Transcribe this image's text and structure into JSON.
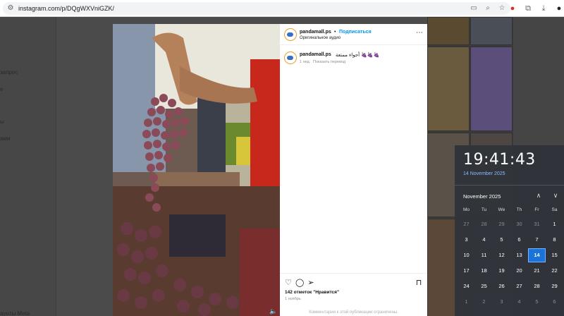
{
  "browser": {
    "url": "instagram.com/p/DQgWXVniGZK/"
  },
  "sidebar": {
    "items": [
      "запрос",
      "е",
      "ы",
      "ами",
      "аунты Meta"
    ]
  },
  "post": {
    "username": "pandamall.ps",
    "follow_separator": "•",
    "follow_label": "Подписаться",
    "audio_label": "Оригинальное аудио",
    "caption_username": "pandamall.ps",
    "caption_text": "أجواء ممتعة 🍇🍇🍇",
    "caption_age": "1 нед.",
    "translate_label": "Показать перевод",
    "likes": "142 отметок \"Нравится\"",
    "date": "1 ноябрь",
    "comments_off": "Комментарии к этой публикации ограничены."
  },
  "clock": {
    "time": "19:41:43",
    "date": "14 November 2025",
    "month": "November 2025",
    "weekdays": [
      "Mo",
      "Tu",
      "We",
      "Th",
      "Fr",
      "Sa"
    ],
    "weeks": [
      [
        "27",
        "28",
        "29",
        "30",
        "31",
        "1"
      ],
      [
        "3",
        "4",
        "5",
        "6",
        "7",
        "8"
      ],
      [
        "10",
        "11",
        "12",
        "13",
        "14",
        "15"
      ],
      [
        "17",
        "18",
        "19",
        "20",
        "21",
        "22"
      ],
      [
        "24",
        "25",
        "26",
        "27",
        "28",
        "29"
      ],
      [
        "1",
        "2",
        "3",
        "4",
        "5",
        "6"
      ]
    ],
    "today": "14"
  },
  "icons": {
    "tune": "tune-icon",
    "cast": "cast-icon",
    "zoom": "zoom-icon",
    "bookmark_star": "star-icon",
    "extension": "extension-icon",
    "download": "download-icon",
    "like": "heart-icon",
    "comment": "comment-icon",
    "share": "send-icon",
    "save": "bookmark-icon",
    "mute": "speaker-icon",
    "prev_month": "chevron-up-icon",
    "next_month": "chevron-down-icon"
  },
  "colors": {
    "accent": "#0095f6",
    "today": "#1a73d9",
    "clock_date": "#8fb8ff"
  }
}
